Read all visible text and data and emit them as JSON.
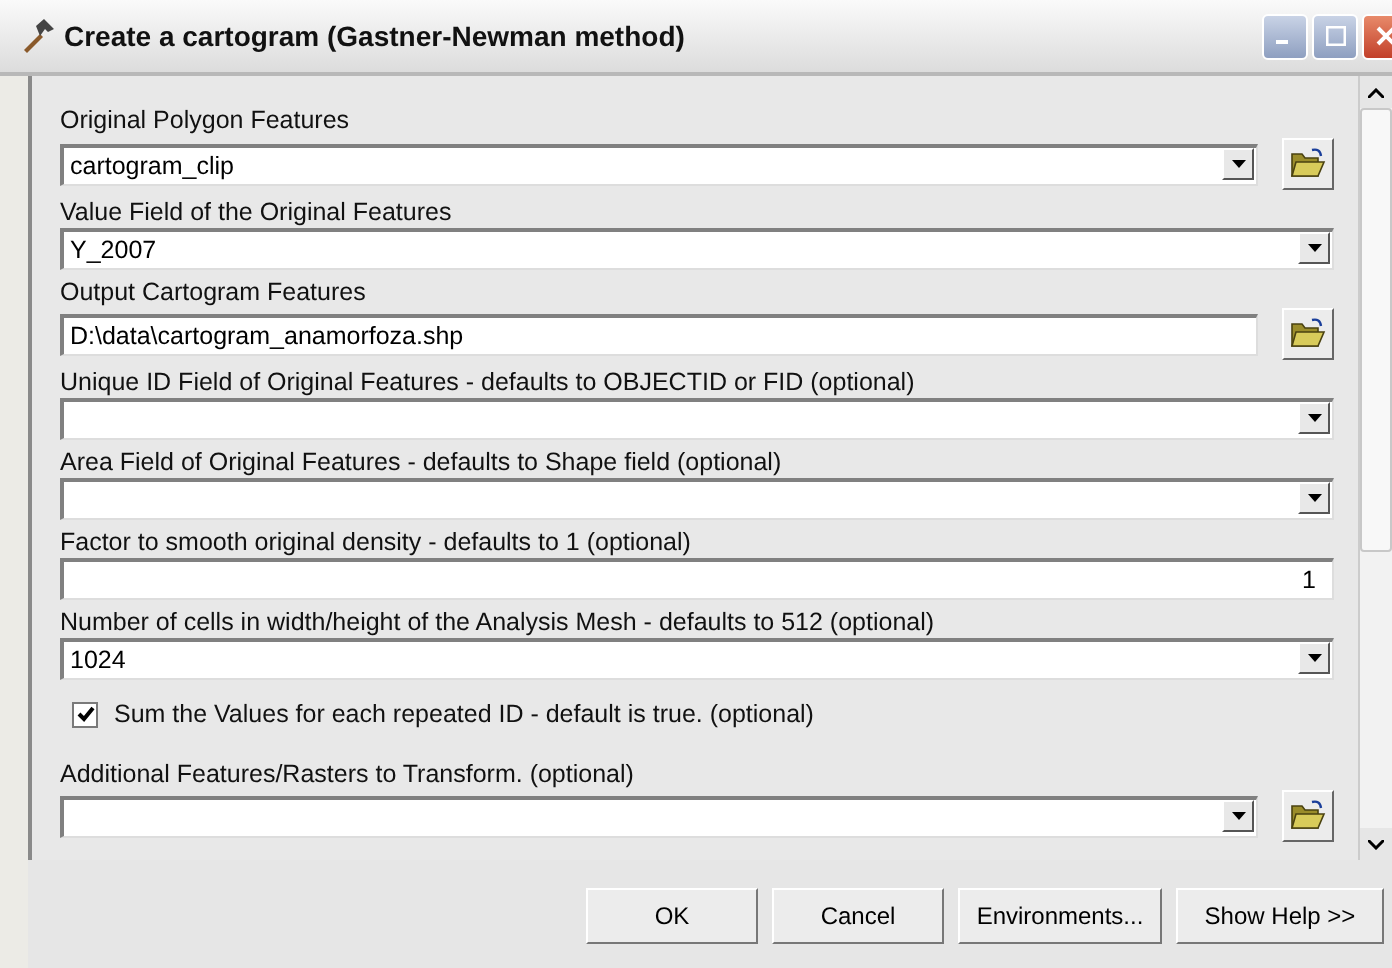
{
  "window": {
    "title": "Create a cartogram (Gastner-Newman method)"
  },
  "parameters": [
    {
      "kind": "combo",
      "label": "Original Polygon Features",
      "value": "cartogram_clip",
      "browse": true
    },
    {
      "kind": "combo",
      "label": "Value Field of the Original Features",
      "value": "Y_2007",
      "browse": false
    },
    {
      "kind": "text",
      "label": "Output Cartogram Features",
      "value": "D:\\data\\cartogram_anamorfoza.shp",
      "browse": true
    },
    {
      "kind": "combo",
      "label": "Unique ID Field of Original Features - defaults to OBJECTID or FID (optional)",
      "browse": false
    },
    {
      "kind": "combo",
      "label": "Area Field of Original Features - defaults to Shape field (optional)",
      "browse": false
    },
    {
      "kind": "number",
      "label": "Factor to smooth original density - defaults to 1 (optional)",
      "value": "1",
      "browse": false
    },
    {
      "kind": "combo",
      "label": "Number of cells in width/height of the Analysis Mesh - defaults to 512 (optional)",
      "value": "1024",
      "browse": false
    },
    {
      "kind": "checkbox",
      "label": "Sum the Values for each repeated ID - default is true. (optional)",
      "checked": true
    },
    {
      "kind": "combo",
      "label": "Additional Features/Rasters to Transform. (optional)",
      "browse": true
    }
  ],
  "buttons": [
    "OK",
    "Cancel",
    "Environments...",
    "Show Help >>"
  ]
}
